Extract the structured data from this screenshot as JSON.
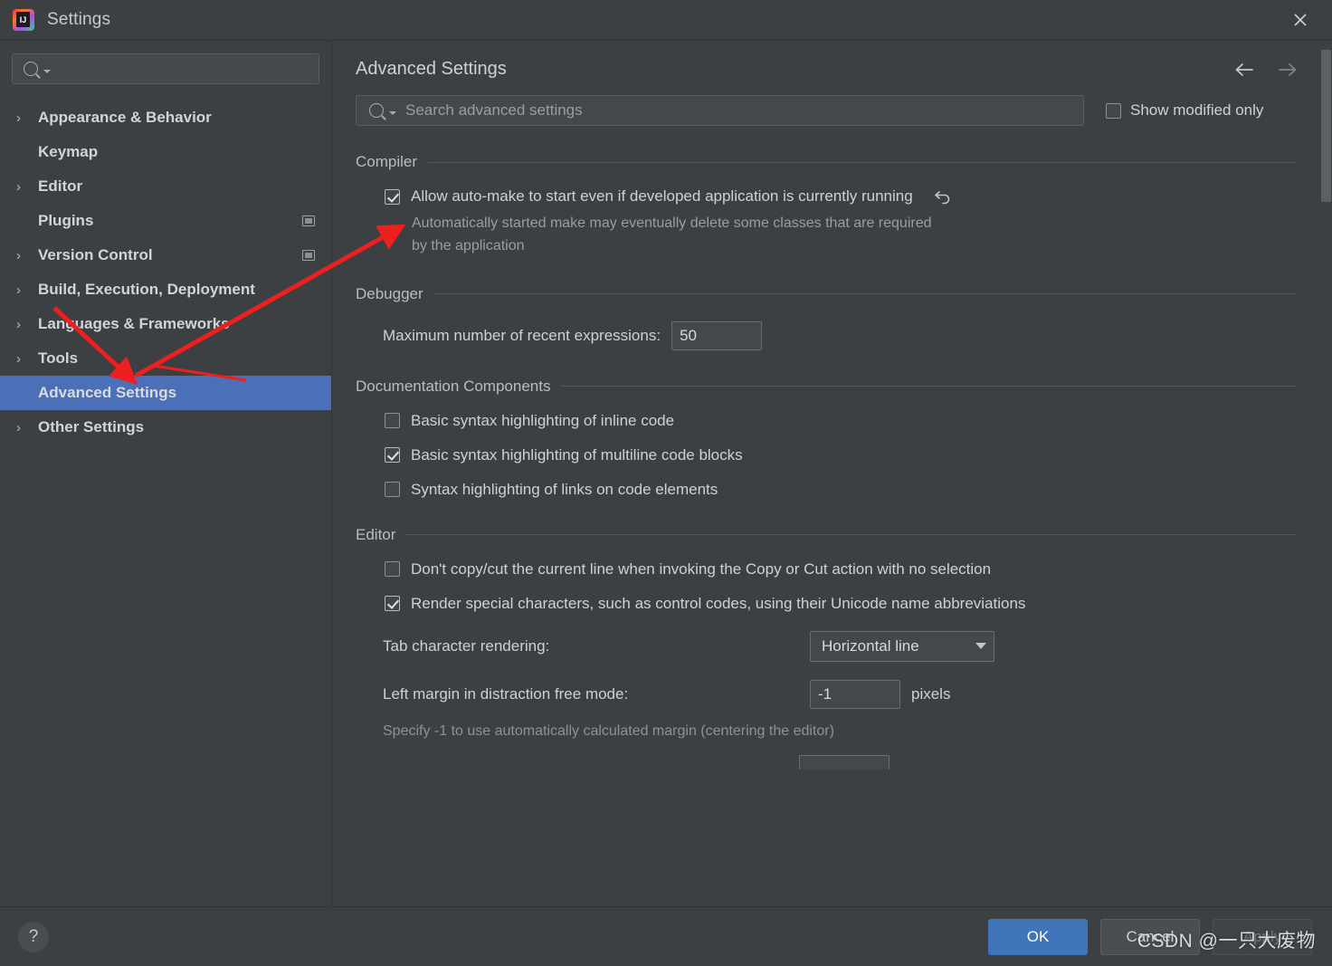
{
  "window": {
    "title": "Settings",
    "logo_icon": "intellij-idea-logo",
    "close_icon": "close-icon"
  },
  "sidebar": {
    "search": {
      "placeholder": "",
      "value": "",
      "icon": "search-icon"
    },
    "items": [
      {
        "label": "Appearance & Behavior",
        "expandable": true,
        "selected": false,
        "badge": false
      },
      {
        "label": "Keymap",
        "expandable": false,
        "selected": false,
        "badge": false
      },
      {
        "label": "Editor",
        "expandable": true,
        "selected": false,
        "badge": false
      },
      {
        "label": "Plugins",
        "expandable": false,
        "selected": false,
        "badge": true
      },
      {
        "label": "Version Control",
        "expandable": true,
        "selected": false,
        "badge": true
      },
      {
        "label": "Build, Execution, Deployment",
        "expandable": true,
        "selected": false,
        "badge": false
      },
      {
        "label": "Languages & Frameworks",
        "expandable": true,
        "selected": false,
        "badge": false
      },
      {
        "label": "Tools",
        "expandable": true,
        "selected": false,
        "badge": false
      },
      {
        "label": "Advanced Settings",
        "expandable": false,
        "selected": true,
        "badge": false
      },
      {
        "label": "Other Settings",
        "expandable": true,
        "selected": false,
        "badge": false
      }
    ]
  },
  "main": {
    "title": "Advanced Settings",
    "back_icon": "arrow-left-icon",
    "forward_icon": "arrow-right-icon",
    "search": {
      "placeholder": "Search advanced settings",
      "value": "",
      "icon": "search-icon"
    },
    "show_modified": {
      "label": "Show modified only",
      "checked": false
    },
    "sections": [
      {
        "title": "Compiler",
        "options": [
          {
            "type": "checkbox",
            "label": "Allow auto-make to start even if developed application is currently running",
            "checked": true,
            "revert_icon": "revert-icon",
            "description": "Automatically started make may eventually delete some classes that are required by the application"
          }
        ]
      },
      {
        "title": "Debugger",
        "options": [
          {
            "type": "text",
            "label": "Maximum number of recent expressions:",
            "value": "50"
          }
        ]
      },
      {
        "title": "Documentation Components",
        "options": [
          {
            "type": "checkbox",
            "label": "Basic syntax highlighting of inline code",
            "checked": false
          },
          {
            "type": "checkbox",
            "label": "Basic syntax highlighting of multiline code blocks",
            "checked": true
          },
          {
            "type": "checkbox",
            "label": "Syntax highlighting of links on code elements",
            "checked": false
          }
        ]
      },
      {
        "title": "Editor",
        "options": [
          {
            "type": "checkbox",
            "label": "Don't copy/cut the current line when invoking the Copy or Cut action with no selection",
            "checked": false
          },
          {
            "type": "checkbox",
            "label": "Render special characters, such as control codes, using their Unicode name abbreviations",
            "checked": true
          },
          {
            "type": "combo",
            "label": "Tab character rendering:",
            "value": "Horizontal line"
          },
          {
            "type": "text_unit",
            "label": "Left margin in distraction free mode:",
            "value": "-1",
            "unit": "pixels",
            "hint": "Specify -1 to use automatically calculated margin (centering the editor)"
          }
        ]
      }
    ]
  },
  "footer": {
    "help_label": "?",
    "ok_label": "OK",
    "cancel_label": "Cancel",
    "apply_label": "Apply"
  },
  "watermark": "CSDN @一只大废物",
  "colors": {
    "accent_selection": "#4b70b8",
    "primary_button": "#3f74b8",
    "annotation_red": "#ef1f1f",
    "panel_bg": "#3c4043"
  }
}
